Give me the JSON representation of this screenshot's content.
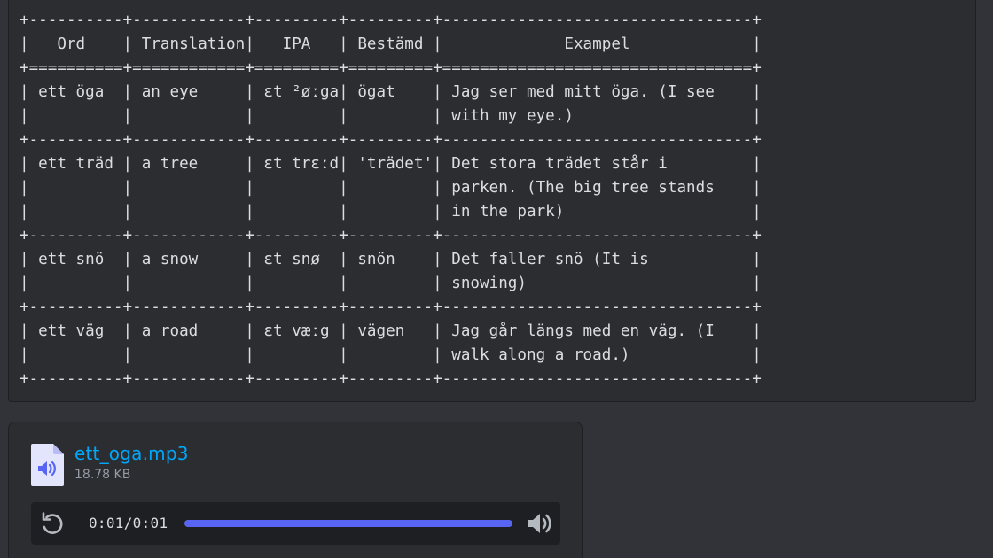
{
  "code_block": {
    "lines": [
      "+----------+------------+---------+---------+---------------------------------+",
      "|   Ord    | Translation|   IPA   | Bestämd |             Exampel             |",
      "+==========+============+=========+=========+=================================+",
      "| ett öga  | an eye     | ɛt ²øːga| ögat    | Jag ser med mitt öga. (I see    |",
      "|          |            |         |         | with my eye.)                   |",
      "+----------+------------+---------+---------+---------------------------------+",
      "| ett träd | a tree     | ɛt trɛːd| 'trädet'| Det stora trädet står i         |",
      "|          |            |         |         | parken. (The big tree stands    |",
      "|          |            |         |         | in the park)                    |",
      "+----------+------------+---------+---------+---------------------------------+",
      "| ett snö  | a snow     | ɛt snø  | snön    | Det faller snö (It is           |",
      "|          |            |         |         | snowing)                        |",
      "+----------+------------+---------+---------+---------------------------------+",
      "| ett väg  | a road     | ɛt væːg | vägen   | Jag går längs med en väg. (I    |",
      "|          |            |         |         | walk along a road.)             |",
      "+----------+------------+---------+---------+---------------------------------+"
    ]
  },
  "attachment": {
    "file_name": "ett_oga.mp3",
    "file_size": "18.78 KB",
    "file_icon": "audio-file-icon",
    "player": {
      "time_display": "0:01/0:01",
      "progress": 1.0,
      "replay_icon": "replay-icon",
      "volume_icon": "volume-icon"
    }
  },
  "colors": {
    "background": "#313338",
    "panel": "#2b2d31",
    "player_bg": "#1e1f22",
    "link": "#00a8fc",
    "progress": "#5865f2",
    "text": "#dbdee1",
    "muted": "#949ba4"
  }
}
